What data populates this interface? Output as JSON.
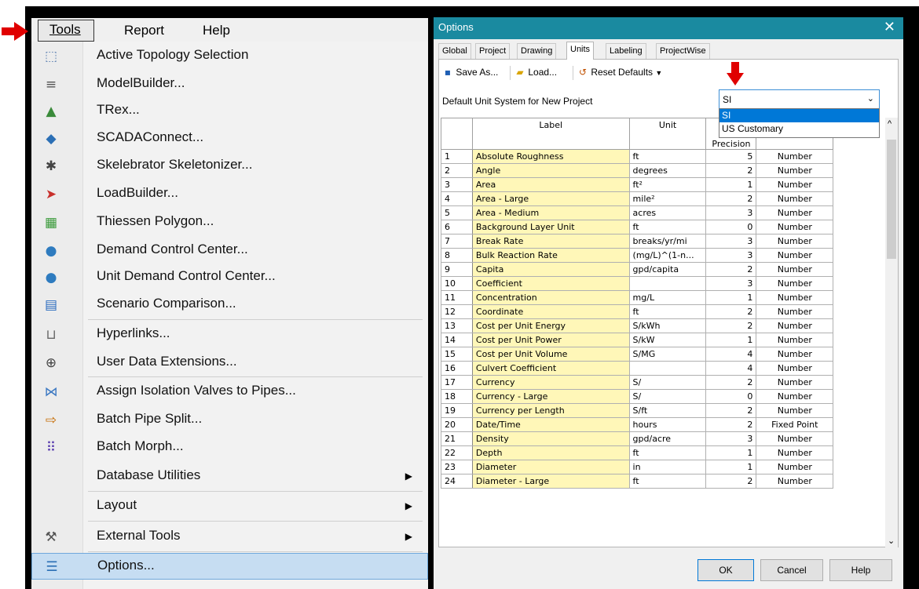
{
  "menubar": {
    "tools": "Tools",
    "report": "Report",
    "help": "Help"
  },
  "menu": [
    {
      "label": "Active Topology Selection",
      "icon": "topology-icon",
      "glyph": "⬚"
    },
    {
      "label": "ModelBuilder...",
      "icon": "modelbuilder-icon",
      "glyph": "≡"
    },
    {
      "label": "TRex...",
      "icon": "trex-icon",
      "glyph": "▲"
    },
    {
      "label": "SCADAConnect...",
      "icon": "scada-icon",
      "glyph": "◆"
    },
    {
      "label": "Skelebrator Skeletonizer...",
      "icon": "skelebrator-icon",
      "glyph": "✱"
    },
    {
      "label": "LoadBuilder...",
      "icon": "loadbuilder-icon",
      "glyph": "➤"
    },
    {
      "label": "Thiessen Polygon...",
      "icon": "thiessen-icon",
      "glyph": "▦"
    },
    {
      "label": "Demand Control Center...",
      "icon": "demand-icon",
      "glyph": "●"
    },
    {
      "label": "Unit Demand Control Center...",
      "icon": "unit-demand-icon",
      "glyph": "●"
    },
    {
      "label": "Scenario Comparison...",
      "icon": "scenario-icon",
      "glyph": "▤"
    },
    {
      "label": "Hyperlinks...",
      "icon": "hyperlink-icon",
      "glyph": "⊔"
    },
    {
      "label": "User Data Extensions...",
      "icon": "user-data-icon",
      "glyph": "⊕"
    },
    {
      "label": "Assign Isolation Valves to Pipes...",
      "icon": "valve-icon",
      "glyph": "⋈"
    },
    {
      "label": "Batch Pipe Split...",
      "icon": "pipe-split-icon",
      "glyph": "⇨"
    },
    {
      "label": "Batch Morph...",
      "icon": "morph-icon",
      "glyph": "⠿"
    },
    {
      "label": "Database Utilities",
      "icon": "",
      "glyph": ""
    },
    {
      "label": "Layout",
      "icon": "",
      "glyph": ""
    },
    {
      "label": "External Tools",
      "icon": "tools-icon",
      "glyph": "⚒"
    },
    {
      "label": "Options...",
      "icon": "options-icon",
      "glyph": "☰"
    }
  ],
  "dialog": {
    "title": "Options",
    "close": "✕",
    "tabs": [
      "Global",
      "Project",
      "Drawing",
      "Units",
      "Labeling",
      "ProjectWise"
    ],
    "toolbar": {
      "save_as": "Save As...",
      "load": "Load...",
      "reset": "Reset Defaults"
    },
    "default_unit_label": "Default Unit System for New Project",
    "default_unit_value": "SI",
    "unit_options": [
      "SI",
      "US Customary"
    ],
    "columns": {
      "label": "Label",
      "unit": "Unit",
      "precision": "Precision"
    },
    "rows": [
      {
        "n": "1",
        "label": "Absolute Roughness",
        "unit": "ft",
        "prec": "5",
        "fmt": "Number"
      },
      {
        "n": "2",
        "label": "Angle",
        "unit": "degrees",
        "prec": "2",
        "fmt": "Number"
      },
      {
        "n": "3",
        "label": "Area",
        "unit": "ft²",
        "prec": "1",
        "fmt": "Number"
      },
      {
        "n": "4",
        "label": "Area - Large",
        "unit": "mile²",
        "prec": "2",
        "fmt": "Number"
      },
      {
        "n": "5",
        "label": "Area - Medium",
        "unit": "acres",
        "prec": "3",
        "fmt": "Number"
      },
      {
        "n": "6",
        "label": "Background Layer Unit",
        "unit": "ft",
        "prec": "0",
        "fmt": "Number"
      },
      {
        "n": "7",
        "label": "Break Rate",
        "unit": "breaks/yr/mi",
        "prec": "3",
        "fmt": "Number"
      },
      {
        "n": "8",
        "label": "Bulk Reaction Rate",
        "unit": "(mg/L)^(1-n...",
        "prec": "3",
        "fmt": "Number"
      },
      {
        "n": "9",
        "label": "Capita",
        "unit": "gpd/capita",
        "prec": "2",
        "fmt": "Number"
      },
      {
        "n": "10",
        "label": "Coefficient",
        "unit": "",
        "prec": "3",
        "fmt": "Number"
      },
      {
        "n": "11",
        "label": "Concentration",
        "unit": "mg/L",
        "prec": "1",
        "fmt": "Number"
      },
      {
        "n": "12",
        "label": "Coordinate",
        "unit": "ft",
        "prec": "2",
        "fmt": "Number"
      },
      {
        "n": "13",
        "label": "Cost per Unit Energy",
        "unit": "S/kWh",
        "prec": "2",
        "fmt": "Number"
      },
      {
        "n": "14",
        "label": "Cost per Unit Power",
        "unit": "S/kW",
        "prec": "1",
        "fmt": "Number"
      },
      {
        "n": "15",
        "label": "Cost per Unit Volume",
        "unit": "S/MG",
        "prec": "4",
        "fmt": "Number"
      },
      {
        "n": "16",
        "label": "Culvert Coefficient",
        "unit": "",
        "prec": "4",
        "fmt": "Number"
      },
      {
        "n": "17",
        "label": "Currency",
        "unit": "S/",
        "prec": "2",
        "fmt": "Number"
      },
      {
        "n": "18",
        "label": "Currency - Large",
        "unit": "S/",
        "prec": "0",
        "fmt": "Number"
      },
      {
        "n": "19",
        "label": "Currency per Length",
        "unit": "S/ft",
        "prec": "2",
        "fmt": "Number"
      },
      {
        "n": "20",
        "label": "Date/Time",
        "unit": "hours",
        "prec": "2",
        "fmt": "Fixed Point"
      },
      {
        "n": "21",
        "label": "Density",
        "unit": "gpd/acre",
        "prec": "3",
        "fmt": "Number"
      },
      {
        "n": "22",
        "label": "Depth",
        "unit": "ft",
        "prec": "1",
        "fmt": "Number"
      },
      {
        "n": "23",
        "label": "Diameter",
        "unit": "in",
        "prec": "1",
        "fmt": "Number"
      },
      {
        "n": "24",
        "label": "Diameter - Large",
        "unit": "ft",
        "prec": "2",
        "fmt": "Number"
      }
    ],
    "buttons": {
      "ok": "OK",
      "cancel": "Cancel",
      "help": "Help"
    }
  },
  "colors": {
    "title_bar": "#1a8aa0",
    "label_cell": "#fff7b8",
    "arrow": "#e00000",
    "menu_highlight": "#c6ddf2"
  }
}
